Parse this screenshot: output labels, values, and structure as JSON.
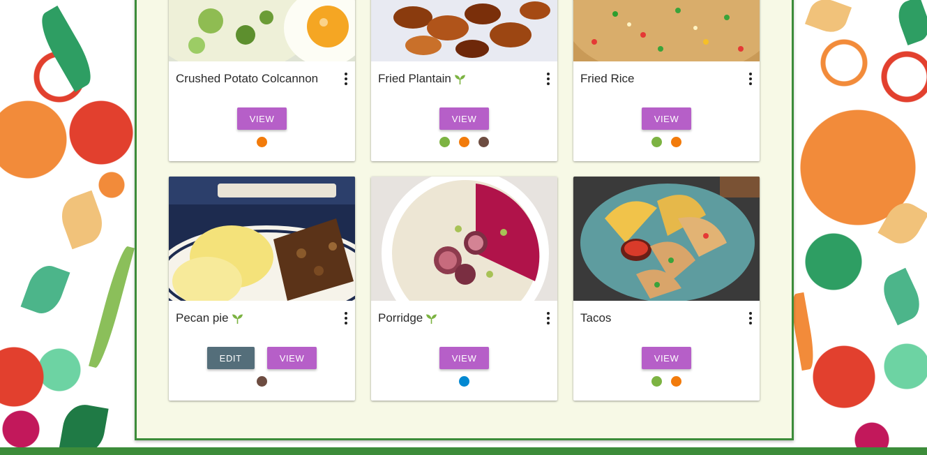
{
  "cards": [
    {
      "title": "Crushed Potato Colcannon",
      "vegetarian": false,
      "image_icon": "colcannon-photo",
      "buttons": [
        {
          "label": "VIEW",
          "kind": "view"
        }
      ],
      "tag_colors": [
        "#f27b0b"
      ]
    },
    {
      "title": "Fried Plantain",
      "vegetarian": true,
      "image_icon": "fried-plantain-photo",
      "buttons": [
        {
          "label": "VIEW",
          "kind": "view"
        }
      ],
      "tag_colors": [
        "#7cb342",
        "#f27b0b",
        "#6d4c41"
      ]
    },
    {
      "title": "Fried Rice",
      "vegetarian": false,
      "image_icon": "fried-rice-photo",
      "buttons": [
        {
          "label": "VIEW",
          "kind": "view"
        }
      ],
      "tag_colors": [
        "#7cb342",
        "#f27b0b"
      ]
    },
    {
      "title": "Pecan pie",
      "vegetarian": true,
      "image_icon": "pecan-pie-photo",
      "buttons": [
        {
          "label": "EDIT",
          "kind": "edit"
        },
        {
          "label": "VIEW",
          "kind": "view"
        }
      ],
      "tag_colors": [
        "#6d4c41"
      ]
    },
    {
      "title": "Porridge",
      "vegetarian": true,
      "image_icon": "porridge-photo",
      "buttons": [
        {
          "label": "VIEW",
          "kind": "view"
        }
      ],
      "tag_colors": [
        "#0288d1"
      ]
    },
    {
      "title": "Tacos",
      "vegetarian": false,
      "image_icon": "tacos-photo",
      "buttons": [
        {
          "label": "VIEW",
          "kind": "view"
        }
      ],
      "tag_colors": [
        "#7cb342",
        "#f27b0b"
      ]
    }
  ],
  "colors": {
    "panel_background": "#f7f9e6",
    "panel_border": "#3c8c3a",
    "view_button": "#b65fc8",
    "edit_button": "#546e7a",
    "vegetarian_icon": "#7cb342"
  }
}
